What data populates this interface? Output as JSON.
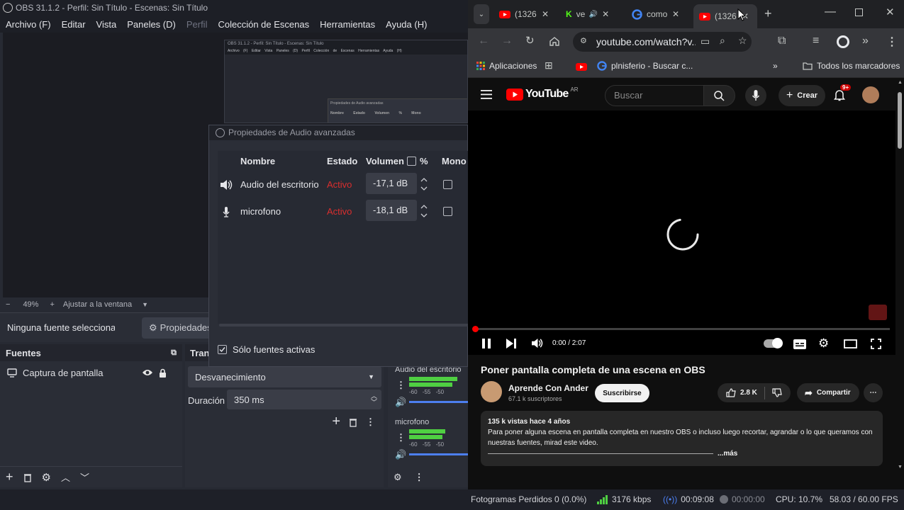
{
  "obs": {
    "title": "OBS 31.1.2 - Perfil: Sin Título - Escenas: Sin Título",
    "menu": [
      "Archivo (F)",
      "Editar",
      "Vista",
      "Paneles (D)",
      "Perfil",
      "Colección de Escenas",
      "Herramientas",
      "Ayuda (H)"
    ],
    "nested_preview": {
      "title": "OBS 31.1.2 - Perfil: Sin Título - Escenas: Sin Título",
      "menu": "Archivo (F) Editar Vista Paneles (D) Perfil Colección de Escenas Herramientas Ayuda (H)",
      "panel_title": "Propiedades de Audio avanzadas",
      "panel_cols": "Nombre Estado Volumen % Mono"
    },
    "zoom": {
      "minus": "−",
      "value": "49%",
      "plus": "+",
      "fit_label": "Ajustar a la ventana"
    },
    "source_bar": {
      "no_source": "Ninguna fuente seleccionada",
      "properties": "Propiedades"
    },
    "sources": {
      "title": "Fuentes",
      "items": [
        {
          "name": "Captura de pantalla"
        }
      ]
    },
    "transitions": {
      "title": "Transiciones de escena",
      "type": "Desvanecimiento",
      "duration_label": "Duración",
      "duration_value": "350 ms"
    },
    "mixer": {
      "tracks": [
        {
          "name": "Audio del escritorio",
          "scale": "-60 -55 -50"
        },
        {
          "name": "microfono",
          "scale": "-60 -55 -50"
        }
      ]
    },
    "audio_dialog": {
      "title": "Propiedades de Audio avanzadas",
      "columns": {
        "name": "Nombre",
        "status": "Estado",
        "volume": "Volumen",
        "percent": "%",
        "mono": "Mono"
      },
      "rows": [
        {
          "name": "Audio del escritorio",
          "status": "Activo",
          "volume": "-17,1 dB"
        },
        {
          "name": "microfono",
          "status": "Activo",
          "volume": "-18,1 dB"
        }
      ],
      "active_only_label": "Sólo fuentes activas"
    },
    "status": {
      "dropped_frames": "Fotogramas Perdidos 0 (0.0%)",
      "bitrate": "3176 kbps",
      "stream_time": "00:09:08",
      "rec_time": "00:00:00",
      "cpu": "CPU: 10.7%",
      "fps": "58.03 / 60.00 FPS"
    }
  },
  "chrome": {
    "tabs": [
      {
        "label": "(1326"
      },
      {
        "label": "ve"
      },
      {
        "label": "como"
      },
      {
        "label": "(1326"
      }
    ],
    "address": "youtube.com/watch?v...",
    "bookmarks": {
      "apps": "Aplicaciones",
      "site": "plnisferio - Buscar c...",
      "all": "Todos los marcadores"
    }
  },
  "youtube": {
    "logo_text": "YouTube",
    "region": "AR",
    "search_placeholder": "Buscar",
    "create_label": "Crear",
    "notif_badge": "9+",
    "time": "0:00 / 2:07",
    "video_title": "Poner pantalla completa de una escena en OBS",
    "channel": "Aprende Con Ander",
    "subscribers": "67.1 k suscriptores",
    "subscribe_label": "Suscribirse",
    "likes": "2.8 K",
    "share_label": "Compartir",
    "views_date": "135 k vistas  hace 4 años",
    "description": "Para poner alguna escena en pantalla completa en nuestro OBS o incluso luego recortar, agrandar o lo que queramos con nuestras fuentes, mirad este video.",
    "more_label": "...más"
  },
  "colors": {
    "accent_blue": "#4d7ff0",
    "status_active": "#d92e2e",
    "yt_red": "#ff0000",
    "meter_green": "#4fcf42"
  }
}
